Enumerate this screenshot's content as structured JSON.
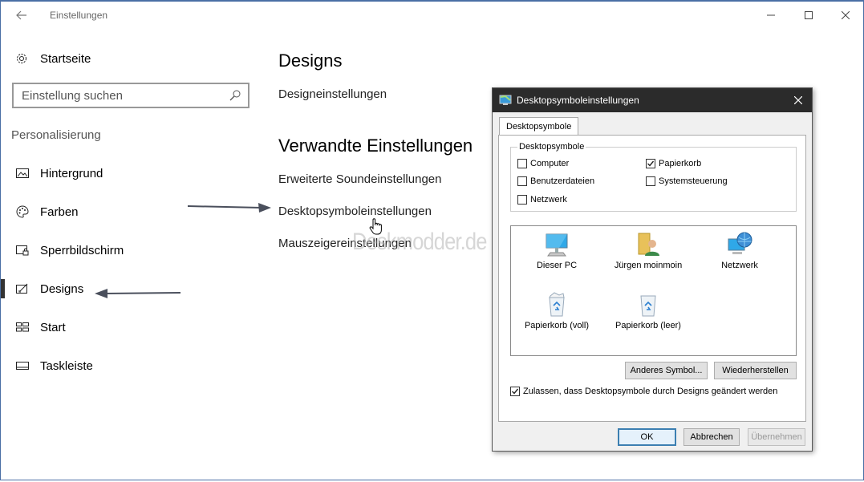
{
  "window": {
    "title": "Einstellungen"
  },
  "sidebar": {
    "home_label": "Startseite",
    "search_placeholder": "Einstellung suchen",
    "section_label": "Personalisierung",
    "items": [
      {
        "label": "Hintergrund",
        "icon": "image-icon"
      },
      {
        "label": "Farben",
        "icon": "palette-icon"
      },
      {
        "label": "Sperrbildschirm",
        "icon": "lock-screen-icon"
      },
      {
        "label": "Designs",
        "icon": "designs-icon",
        "active": true
      },
      {
        "label": "Start",
        "icon": "start-icon"
      },
      {
        "label": "Taskleiste",
        "icon": "taskbar-icon"
      }
    ]
  },
  "main": {
    "title": "Designs",
    "design_link": "Designeinstellungen",
    "related_title": "Verwandte Einstellungen",
    "links": [
      "Erweiterte Soundeinstellungen",
      "Desktopsymboleinstellungen",
      "Mauszeigereinstellungen"
    ]
  },
  "watermark": "Deskmodder.de",
  "dialog": {
    "title": "Desktopsymboleinstellungen",
    "tab": "Desktopsymbole",
    "group_label": "Desktopsymbole",
    "checkboxes": [
      {
        "label": "Computer",
        "checked": false
      },
      {
        "label": "Papierkorb",
        "checked": true
      },
      {
        "label": "Benutzerdateien",
        "checked": false
      },
      {
        "label": "Systemsteuerung",
        "checked": false
      },
      {
        "label": "Netzwerk",
        "checked": false
      }
    ],
    "icons": [
      {
        "label": "Dieser PC",
        "icon": "monitor-icon"
      },
      {
        "label": "Jürgen moinmoin",
        "icon": "user-folder-icon"
      },
      {
        "label": "Netzwerk",
        "icon": "network-globe-icon"
      },
      {
        "label": "Papierkorb (voll)",
        "icon": "recycle-bin-full-icon"
      },
      {
        "label": "Papierkorb (leer)",
        "icon": "recycle-bin-empty-icon"
      }
    ],
    "buttons": {
      "change_icon": "Anderes Symbol...",
      "restore": "Wiederherstellen",
      "ok": "OK",
      "cancel": "Abbrechen",
      "apply": "Übernehmen"
    },
    "allow_themes": {
      "label": "Zulassen, dass Desktopsymbole durch Designs geändert werden",
      "checked": true
    }
  },
  "colors": {
    "accent": "#3c7fb1",
    "dialog_title_bg": "#2b2b2b",
    "arrow": "#4a4f5c"
  }
}
